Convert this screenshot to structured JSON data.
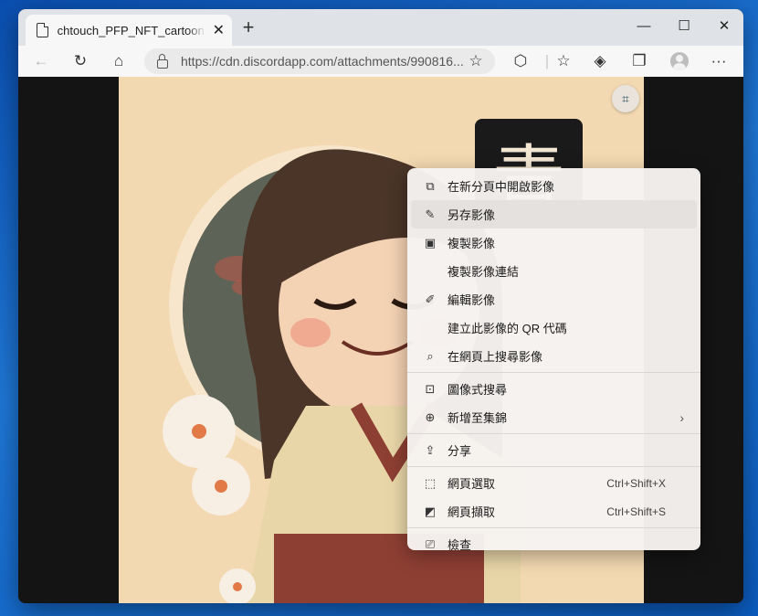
{
  "tab": {
    "title": "chtouch_PFP_NFT_cartoon_girl_s",
    "close_label": "✕",
    "new_tab_label": "+"
  },
  "window_controls": {
    "minimize": "—",
    "maximize": "☐",
    "close": "✕"
  },
  "toolbar": {
    "url": "https://cdn.discordapp.com/attachments/990816..."
  },
  "image_sign_text": "青",
  "context_menu": {
    "groups": [
      [
        {
          "icon": "open-new-tab-icon",
          "label": "在新分頁中開啟影像",
          "shortcut": ""
        },
        {
          "icon": "save-image-icon",
          "label": "另存影像",
          "shortcut": "",
          "highlighted": true
        },
        {
          "icon": "copy-image-icon",
          "label": "複製影像",
          "shortcut": ""
        },
        {
          "icon": "",
          "label": "複製影像連結",
          "shortcut": ""
        },
        {
          "icon": "edit-image-icon",
          "label": "編輯影像",
          "shortcut": ""
        },
        {
          "icon": "",
          "label": "建立此影像的 QR 代碼",
          "shortcut": ""
        },
        {
          "icon": "search-web-image-icon",
          "label": "在網頁上搜尋影像",
          "shortcut": ""
        }
      ],
      [
        {
          "icon": "visual-search-icon",
          "label": "圖像式搜尋",
          "shortcut": ""
        },
        {
          "icon": "add-collection-icon",
          "label": "新增至集錦",
          "shortcut": "",
          "submenu": true
        }
      ],
      [
        {
          "icon": "share-icon",
          "label": "分享",
          "shortcut": ""
        }
      ],
      [
        {
          "icon": "web-select-icon",
          "label": "網頁選取",
          "shortcut": "Ctrl+Shift+X"
        },
        {
          "icon": "web-capture-icon",
          "label": "網頁擷取",
          "shortcut": "Ctrl+Shift+S"
        }
      ],
      [
        {
          "icon": "inspect-icon",
          "label": "檢查",
          "shortcut": ""
        }
      ]
    ]
  }
}
